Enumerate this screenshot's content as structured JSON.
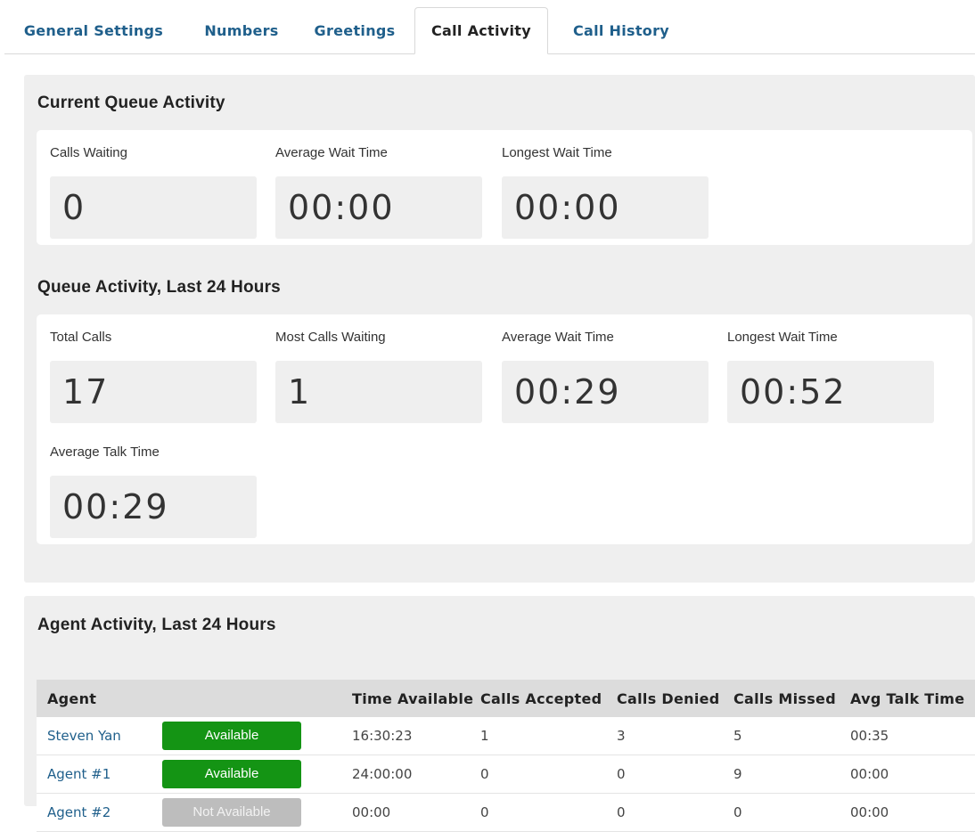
{
  "tabs": [
    {
      "label": "General Settings",
      "active": false
    },
    {
      "label": "Numbers",
      "active": false
    },
    {
      "label": "Greetings",
      "active": false
    },
    {
      "label": "Call Activity",
      "active": true
    },
    {
      "label": "Call History",
      "active": false
    }
  ],
  "current_queue": {
    "title": "Current Queue Activity",
    "stats": [
      {
        "label": "Calls Waiting",
        "value": "0"
      },
      {
        "label": "Average Wait Time",
        "value": "00:00"
      },
      {
        "label": "Longest Wait Time",
        "value": "00:00"
      }
    ]
  },
  "queue_24h": {
    "title": "Queue Activity, Last 24 Hours",
    "stats": [
      {
        "label": "Total Calls",
        "value": "17"
      },
      {
        "label": "Most Calls Waiting",
        "value": "1"
      },
      {
        "label": "Average Wait Time",
        "value": "00:29"
      },
      {
        "label": "Longest Wait Time",
        "value": "00:52"
      },
      {
        "label": "Average Talk Time",
        "value": "00:29"
      }
    ]
  },
  "agent_activity": {
    "title": "Agent Activity, Last 24 Hours",
    "columns": [
      "Agent",
      "",
      "Time Available",
      "Calls Accepted",
      "Calls Denied",
      "Calls Missed",
      "Avg Talk Time"
    ],
    "rows": [
      {
        "agent": "Steven Yan",
        "status": "Available",
        "time_available": "16:30:23",
        "calls_accepted": "1",
        "calls_denied": "3",
        "calls_missed": "5",
        "avg_talk_time": "00:35"
      },
      {
        "agent": "Agent #1",
        "status": "Available",
        "time_available": "24:00:00",
        "calls_accepted": "0",
        "calls_denied": "0",
        "calls_missed": "9",
        "avg_talk_time": "00:00"
      },
      {
        "agent": "Agent #2",
        "status": "Not Available",
        "time_available": "00:00",
        "calls_accepted": "0",
        "calls_denied": "0",
        "calls_missed": "0",
        "avg_talk_time": "00:00"
      }
    ]
  },
  "colors": {
    "link": "#1f5f8b",
    "available": "#149414",
    "not_available": "#bdbdbd",
    "panel_bg": "#efefef"
  }
}
